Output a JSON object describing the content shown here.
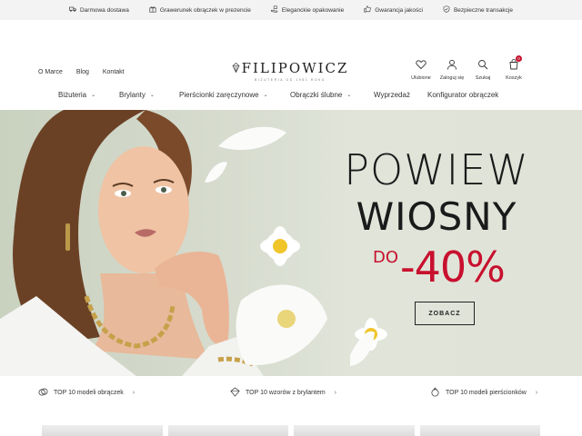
{
  "topbar": {
    "items": [
      {
        "icon": "truck-icon",
        "label": "Darmowa dostawa"
      },
      {
        "icon": "gift-icon",
        "label": "Grawerunek obrączek w prezencie"
      },
      {
        "icon": "hand-gift-icon",
        "label": "Eleganckie opakowanie"
      },
      {
        "icon": "thumbs-up-icon",
        "label": "Gwarancja jakości"
      },
      {
        "icon": "shield-check-icon",
        "label": "Bezpieczne transakcje"
      }
    ]
  },
  "header": {
    "links": [
      "O Marce",
      "Blog",
      "Kontakt"
    ],
    "logo": {
      "name": "FILIPOWICZ",
      "sub": "BIŻUTERIA OD 1981 ROKU"
    },
    "icons": [
      {
        "icon": "heart-icon",
        "label": "Ulubione"
      },
      {
        "icon": "user-icon",
        "label": "Zaloguj się"
      },
      {
        "icon": "search-icon",
        "label": "Szukaj"
      },
      {
        "icon": "cart-icon",
        "label": "Koszyk",
        "badge": "0"
      }
    ]
  },
  "nav": {
    "items": [
      {
        "label": "Biżuteria",
        "dropdown": true
      },
      {
        "label": "Brylanty",
        "dropdown": true
      },
      {
        "label": "Pierścionki zaręczynowe",
        "dropdown": true
      },
      {
        "label": "Obrączki ślubne",
        "dropdown": true
      },
      {
        "label": "Wyprzedaż",
        "dropdown": false
      },
      {
        "label": "Konfigurator obrączek",
        "dropdown": false
      }
    ]
  },
  "hero": {
    "title_line1": "POWIEW",
    "title_line2": "WIOSNY",
    "promo_prefix": "DO",
    "promo_value": "-40%",
    "button": "ZOBACZ",
    "colors": {
      "promo": "#c8102e",
      "text": "#1a1a1a"
    }
  },
  "strip": {
    "items": [
      {
        "icon": "rings-icon",
        "label": "TOP 10 modeli obrączek"
      },
      {
        "icon": "diamond-icon",
        "label": "TOP 10 wzorów z brylantem"
      },
      {
        "icon": "ring-icon",
        "label": "TOP 10 modeli pierścionków"
      }
    ]
  }
}
